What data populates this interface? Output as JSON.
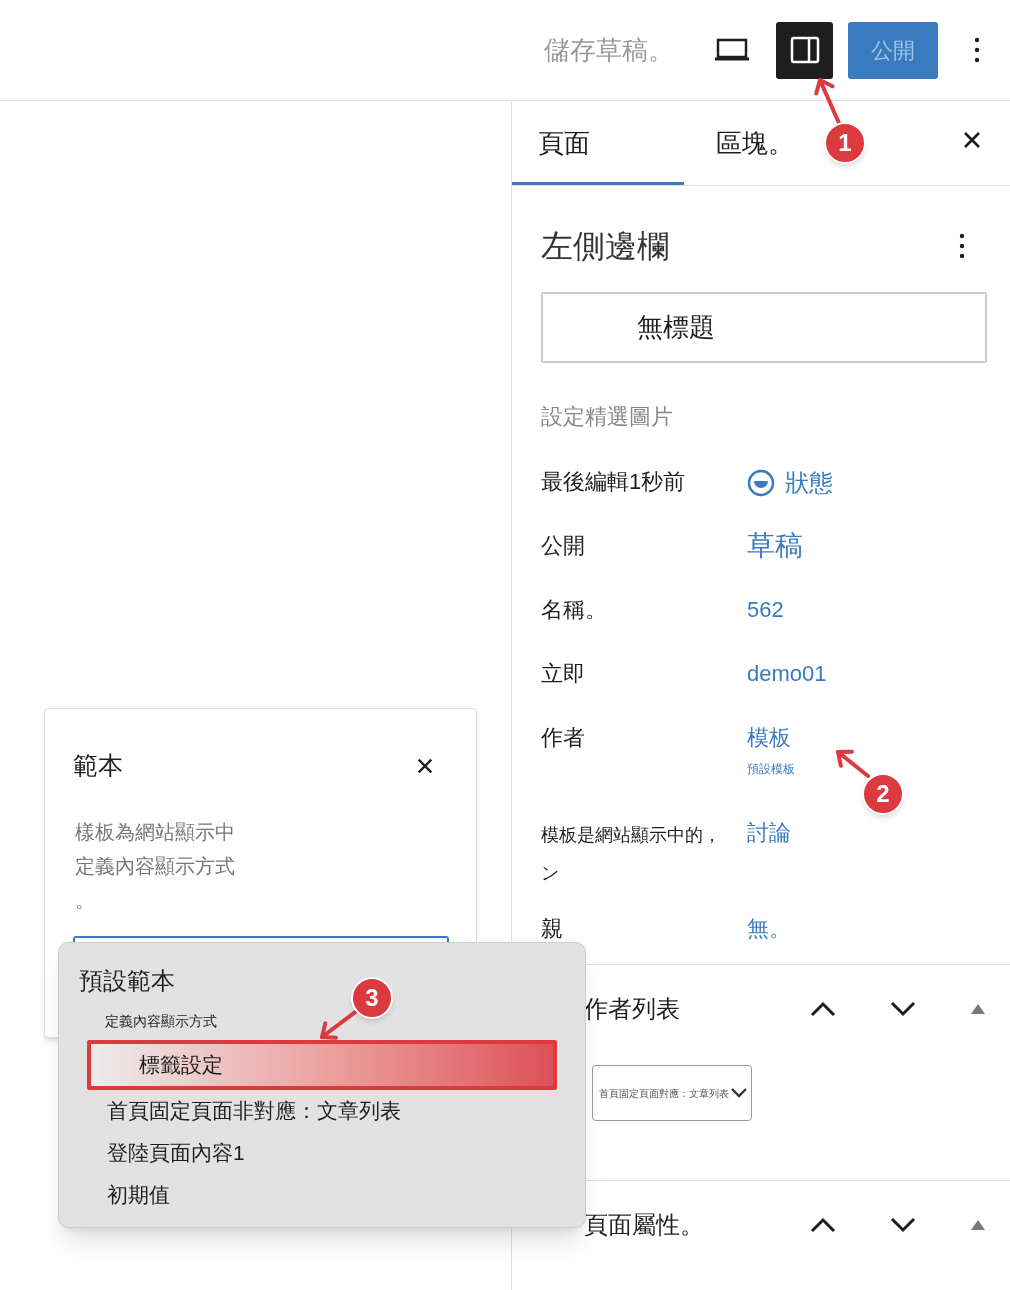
{
  "toolbar": {
    "save_draft": "儲存草稿。",
    "sidebar_toggle": {
      "selected": true
    },
    "publish": "公開"
  },
  "sidebar": {
    "tabs": [
      {
        "label": "頁面",
        "selected": true
      },
      {
        "label": "區塊。",
        "selected": false
      }
    ],
    "title": "左側邊欄",
    "title_field": {
      "value": "無標題"
    },
    "featured_image": "設定精選圖片",
    "rows": [
      {
        "kind": "status",
        "label_lines": [
          "最後編輯1秒前"
        ],
        "value": "狀態"
      },
      {
        "kind": "link",
        "label_lines": [
          "公開"
        ],
        "value": "草稿"
      },
      {
        "kind": "link",
        "label_lines": [
          "名稱。"
        ],
        "value": "562"
      },
      {
        "kind": "link",
        "label_lines": [
          "立即"
        ],
        "value": "demo01"
      },
      {
        "kind": "template",
        "label_lines": [
          "作者"
        ],
        "value": "模板",
        "sub": "預設模板"
      },
      {
        "kind": "link",
        "label_lines": [
          "模板是網站顯示中的，",
          "ン"
        ],
        "value": "討論"
      },
      {
        "kind": "link",
        "label_lines": [
          "親"
        ],
        "value": "無。"
      }
    ],
    "panels": [
      {
        "title": "作者列表",
        "select_value": "首頁固定頁面對應：文章列表"
      },
      {
        "title": "頁面屬性。"
      }
    ]
  },
  "template_popover": {
    "title": "範本",
    "description_lines": [
      "樣板為網站顯示中",
      "定義內容顯示方式",
      "。"
    ]
  },
  "dropdown": {
    "group": "預設範本",
    "hint": "定義內容顯示方式",
    "options": [
      {
        "label": "標籤設定",
        "selected": true
      },
      {
        "label": "首頁固定頁面非對應：文章列表",
        "selected": false
      },
      {
        "label": "登陸頁面內容1",
        "selected": false
      },
      {
        "label": "初期值",
        "selected": false
      }
    ]
  },
  "annotations": [
    {
      "number": "1"
    },
    {
      "number": "2"
    },
    {
      "number": "3"
    }
  ]
}
